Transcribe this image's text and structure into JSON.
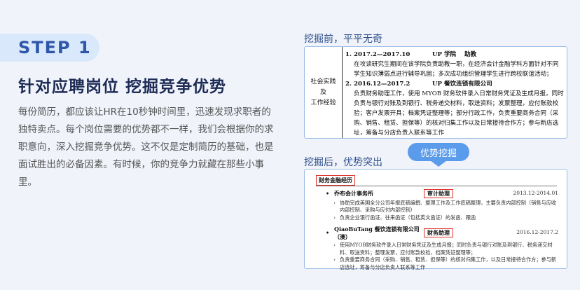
{
  "step_label": "STEP 1",
  "headline": "针对应聘岗位  挖掘竞争优势",
  "body": "每份简历，都应该让HR在10秒钟时间里，迅速发现求职者的独特卖点。每个岗位需要的优势都不一样，我们会根据你的求职意向，深入挖掘竞争优势。这不仅是定制简历的基础，也是面试胜出的必备因素。有时候，你的竞争力就藏在那些小事里。",
  "before": {
    "caption": "挖掘前，平平无奇",
    "side_label_1": "社会实践",
    "side_label_2": "及",
    "side_label_3": "工作经验",
    "jobs": [
      {
        "num": "1.",
        "period": "2017.2—2017.10",
        "company": "UP 学院",
        "role": "助教",
        "desc": "在攻读研究生期间在该学院负责助教一职，在经济会计金融学科方面针对不同学生知识薄弱点进行辅导巩固；多次成功组织管理学生进行跨校联谊活动；"
      },
      {
        "num": "2.",
        "period": "2016.12—2017.2",
        "company": "UP 餐饮连锁有限公司",
        "role": "",
        "desc": "负责财务助理工作，使用 MYOB 财务软件录入日常财务凭证及生成月报，同时负责与银行对账及到银行、税务递交材料，取送资料；发票整理，应付账款校验；客户发票开具；档案凭证整理等；部分行政工作，负责重要商务合同（采购、销售、租赁、担保等）的核对归集工作以及日常接待合作方；参与新店选址，筹备与分店负责人联系等工作"
      }
    ]
  },
  "arrow_label": "优势挖掘",
  "after": {
    "caption": "挖掘后，优势突出",
    "section_title": "财务金融经历",
    "jobs": [
      {
        "company": "乔布会计事务所",
        "role": "审计助理",
        "date": "2013.12-2014.01",
        "bullets": [
          "协助完成美国全分公司年报底稿编撰、整理工作及工作底稿整理，主要负责内部控制（销售与应收内部控制、采购与应付内部控制）",
          "负责企业银行函证、往来函证（包括英文函证）的发函、跟函"
        ]
      },
      {
        "company": "QiaoBuTang 餐饮连锁有限公司（澳）",
        "role": "财务助理",
        "date": "2016.12-2017.2",
        "bullets": [
          "使用MYOB财务软件录入日常财务凭证及生成月报；同时负责与银行对账及到银行、税务递交材料、取送资料；整理发票，应付账款校验，档案凭证整理等；",
          "负责重要商务合同（采购、销售、租赁、担保等）的核对归集工作，以及日常接待合作方；参与新店选址，筹备与分店负责人联系等工作"
        ]
      }
    ]
  },
  "colors": {
    "accent": "#2f57a8",
    "highlight": "#e0312b",
    "badge": "#5b9bec"
  }
}
